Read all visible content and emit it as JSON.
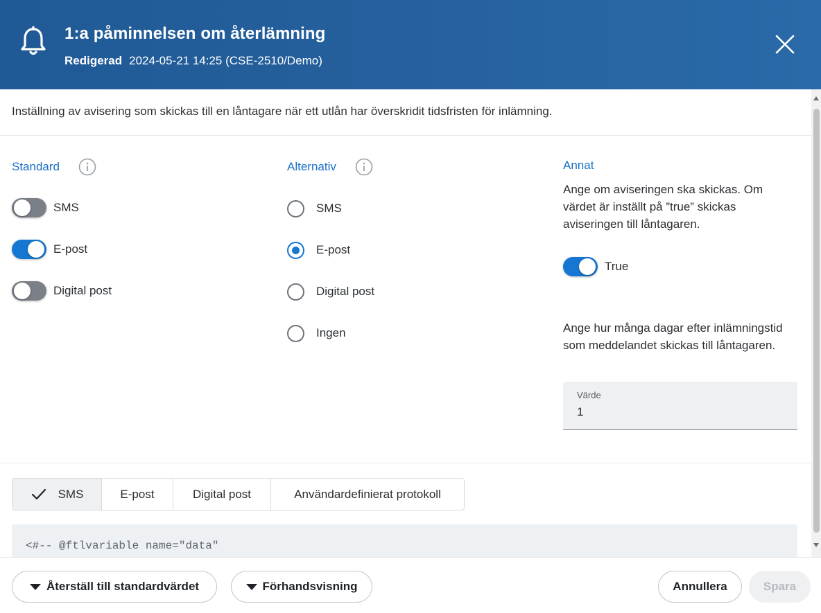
{
  "header": {
    "title": "1:a påminnelsen om återlämning",
    "subtitle_label": "Redigerad",
    "subtitle_value": "2024-05-21 14:25 (CSE-2510/Demo)"
  },
  "description": "Inställning av avisering som skickas till en låntagare när ett utlån har överskridit tidsfristen för inlämning.",
  "standard": {
    "title": "Standard",
    "items": [
      {
        "label": "SMS",
        "enabled": false
      },
      {
        "label": "E-post",
        "enabled": true
      },
      {
        "label": "Digital post",
        "enabled": false
      }
    ]
  },
  "alternativ": {
    "title": "Alternativ",
    "selected": "E-post",
    "options": [
      "SMS",
      "E-post",
      "Digital post",
      "Ingen"
    ]
  },
  "annat": {
    "title": "Annat",
    "send_description": "Ange om aviseringen ska skickas. Om värdet är inställt på ”true” skickas aviseringen till låntagaren.",
    "send_toggle_label": "True",
    "send_enabled": true,
    "days_description": "Ange hur många dagar efter inlämningstid som meddelandet skickas till låntagaren.",
    "field_label": "Värde",
    "field_value": "1"
  },
  "tabs": [
    {
      "label": "SMS",
      "active": true
    },
    {
      "label": "E-post",
      "active": false
    },
    {
      "label": "Digital post",
      "active": false
    },
    {
      "label": "Användardefinierat protokoll",
      "active": false
    }
  ],
  "code_line": "<#-- @ftlvariable name=\"data\"",
  "footer": {
    "reset_label": "Återställ till standardvärdet",
    "preview_label": "Förhandsvisning",
    "cancel_label": "Annullera",
    "save_label": "Spara"
  },
  "colors": {
    "header_bg": "#245f9c",
    "accent": "#1677d2",
    "toggle_off": "#7b8088"
  }
}
